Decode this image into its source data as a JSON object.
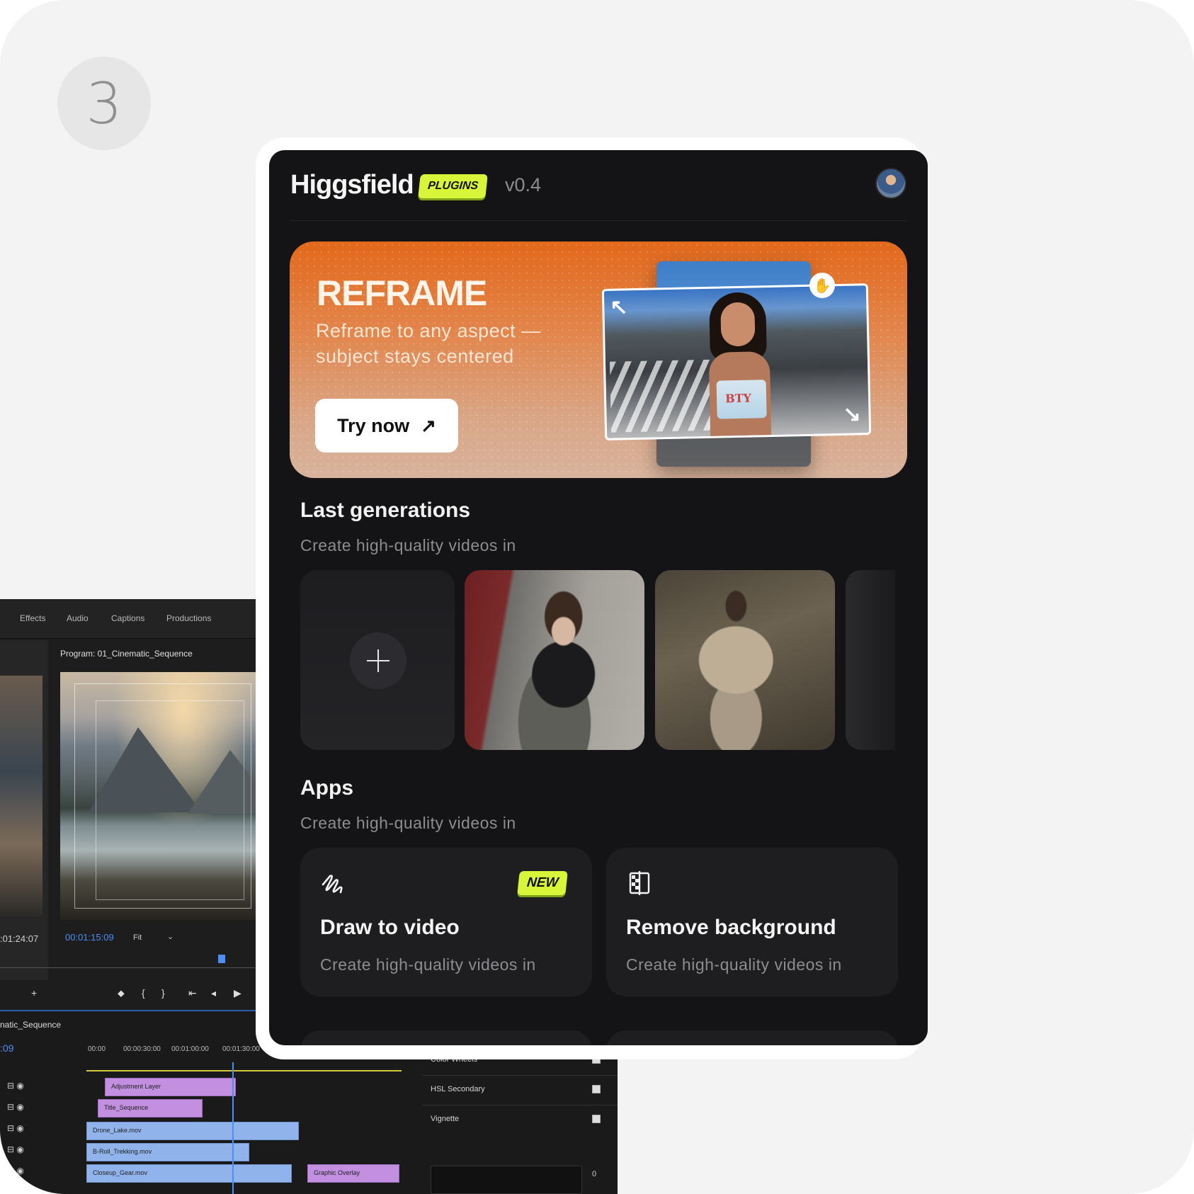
{
  "step": {
    "number": "3"
  },
  "plugin": {
    "brand": "Higgsfield",
    "badge": "PLUGINS",
    "version": "v0.4",
    "banner": {
      "title": "REFRAME",
      "subtitle": "Reframe to any aspect — subject stays centered",
      "cta": "Try now",
      "cta_icon": "arrow-up-right-icon",
      "photo_text": "BTY"
    },
    "last_generations": {
      "title": "Last generations",
      "subtitle": "Create high-quality videos in"
    },
    "apps": {
      "title": "Apps",
      "subtitle": "Create high-quality videos in",
      "items": [
        {
          "title": "Draw to video",
          "subtitle": "Create high-quality videos in",
          "badge": "NEW",
          "icon": "draw-scribble-icon"
        },
        {
          "title": "Remove background",
          "subtitle": "Create high-quality videos in",
          "icon": "remove-background-icon"
        }
      ]
    },
    "accent_color": "#d9f53a",
    "banner_color": "#e2681b"
  },
  "editor": {
    "tabs": [
      "Effects",
      "Audio",
      "Captions",
      "Productions"
    ],
    "monitor_title": "Program: 01_Cinematic_Sequence",
    "left_time": ":01:24:07",
    "timecode": "00:01:15:09",
    "fit": "Fit",
    "sequence_title": "natic_Sequence",
    "sequence_time": ":09",
    "ruler": [
      "00:00",
      "00:00:30:00",
      "00:01:00:00",
      "00:01:30:00"
    ],
    "clips": [
      "Adjustment Layer",
      "Title_Sequence",
      "Drone_Lake.mov",
      "B-Roll_Trekking.mov",
      "Closeup_Gear.mov",
      "Graphic Overlay"
    ],
    "right_items": [
      "Color Wheels",
      "HSL Secondary",
      "Vignette"
    ],
    "meter_value": "0"
  }
}
